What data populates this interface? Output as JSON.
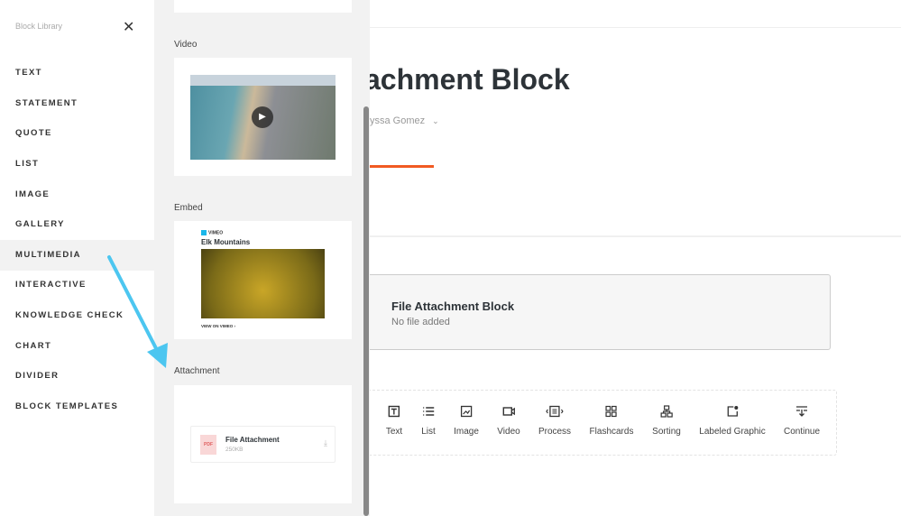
{
  "sidebar": {
    "title": "Block Library",
    "close_icon": "close-icon",
    "items": [
      {
        "label": "TEXT"
      },
      {
        "label": "STATEMENT"
      },
      {
        "label": "QUOTE"
      },
      {
        "label": "LIST"
      },
      {
        "label": "IMAGE"
      },
      {
        "label": "GALLERY"
      },
      {
        "label": "MULTIMEDIA",
        "active": true
      },
      {
        "label": "INTERACTIVE"
      },
      {
        "label": "KNOWLEDGE CHECK"
      },
      {
        "label": "CHART"
      },
      {
        "label": "DIVIDER"
      },
      {
        "label": "BLOCK TEMPLATES"
      }
    ]
  },
  "panel": {
    "video": {
      "label": "Video"
    },
    "embed": {
      "label": "Embed",
      "provider": "VIMEO",
      "video_title": "Elk Mountains",
      "link": "VIEW ON VIMEO ›"
    },
    "attachment": {
      "label": "Attachment",
      "file_name": "File Attachment",
      "file_size": "250KB",
      "file_type": "PDF"
    }
  },
  "main": {
    "title": "achment Block",
    "author": "yssa Gomez",
    "block": {
      "title": "File Attachment Block",
      "subtitle": "No file added"
    },
    "toolbar": [
      {
        "label": "Text"
      },
      {
        "label": "List"
      },
      {
        "label": "Image"
      },
      {
        "label": "Video"
      },
      {
        "label": "Process"
      },
      {
        "label": "Flashcards"
      },
      {
        "label": "Sorting"
      },
      {
        "label": "Labeled Graphic"
      },
      {
        "label": "Continue"
      }
    ]
  },
  "colors": {
    "accent": "#f15a22",
    "arrow": "#4cc6f0"
  }
}
